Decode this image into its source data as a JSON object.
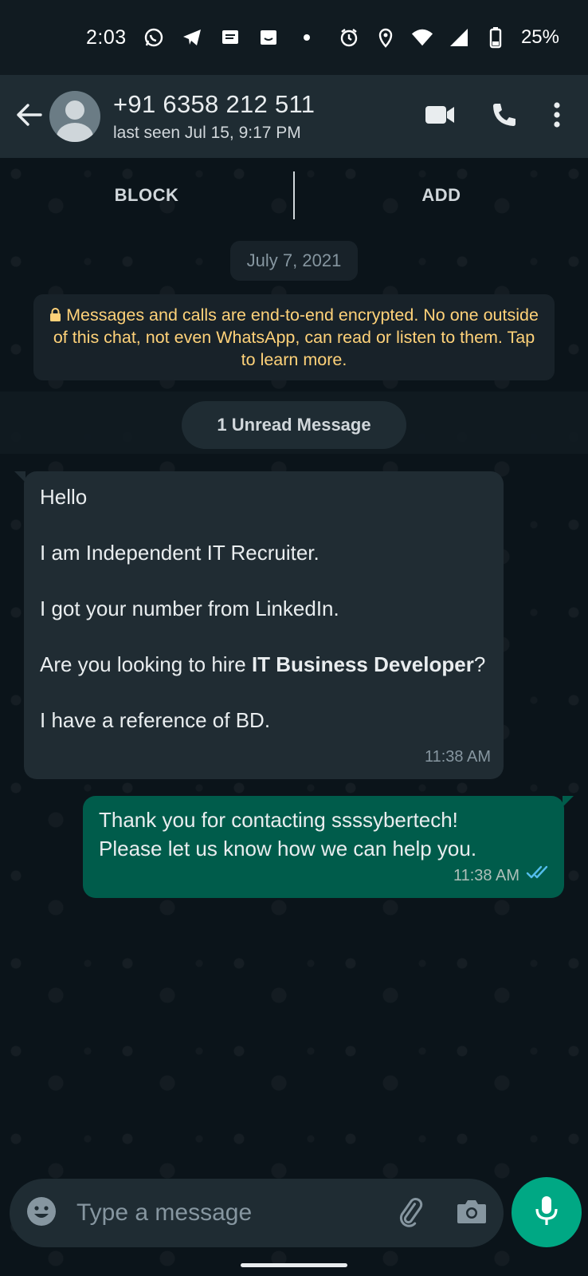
{
  "status_bar": {
    "time": "2:03",
    "battery": "25%"
  },
  "header": {
    "contact_name": "+91 6358 212 511",
    "contact_status": "last seen Jul 15, 9:17 PM"
  },
  "actions": {
    "block_label": "BLOCK",
    "add_label": "ADD"
  },
  "chat": {
    "date_chip": "July 7, 2021",
    "encryption_notice": "Messages and calls are end-to-end encrypted. No one outside of this chat, not even WhatsApp, can read or listen to them. Tap to learn more.",
    "unread_label": "1 Unread Message",
    "incoming": {
      "line1": "Hello",
      "line2": "I am Independent IT Recruiter.",
      "line3": "I got your number from LinkedIn.",
      "line4_prefix": "Are you looking to hire ",
      "line4_bold": "IT Business Developer",
      "line4_suffix": "?",
      "line5": "I have a reference of BD.",
      "time": "11:38 AM"
    },
    "outgoing": {
      "text_line1": "Thank you for contacting ssssybertech!",
      "text_line2": "Please let us know how we can help you.",
      "time": "11:38 AM",
      "status": "read"
    }
  },
  "composer": {
    "placeholder": "Type a message"
  },
  "colors": {
    "accent": "#00a884",
    "outgoing_bubble": "#005c4b",
    "incoming_bubble": "#202c33",
    "header_bg": "#1f2c33",
    "notice_text": "#ffd279",
    "read_ticks": "#53bdeb"
  },
  "icons": {
    "status_left": [
      "whatsapp-icon",
      "telegram-icon",
      "message-icon",
      "amazon-icon",
      "dot-icon"
    ],
    "status_right": [
      "alarm-icon",
      "location-icon",
      "wifi-icon",
      "signal-icon",
      "battery-icon"
    ],
    "header": [
      "back-arrow-icon",
      "video-call-icon",
      "phone-icon",
      "more-vert-icon"
    ],
    "composer": [
      "emoji-icon",
      "attach-icon",
      "camera-icon",
      "mic-icon"
    ]
  }
}
